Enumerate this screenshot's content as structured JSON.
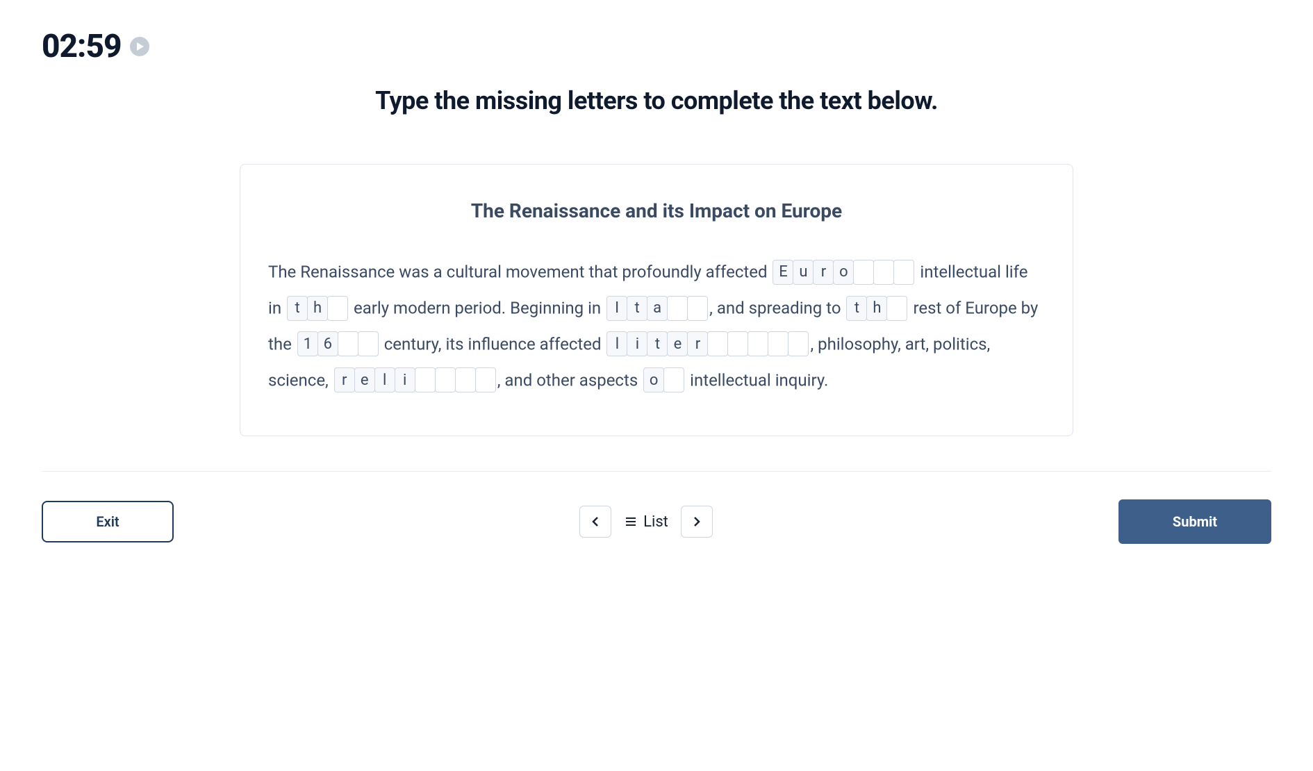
{
  "timer": "02:59",
  "instruction": "Type the missing letters to complete the text below.",
  "card": {
    "title": "The Renaissance and its Impact on Europe",
    "segments": [
      {
        "type": "text",
        "value": "The Renaissance was a cultural movement that profoundly affected "
      },
      {
        "type": "word",
        "letters": [
          "E",
          "u",
          "r",
          "o",
          "",
          "",
          ""
        ]
      },
      {
        "type": "text",
        "value": " intellectual life in "
      },
      {
        "type": "word",
        "letters": [
          "t",
          "h",
          ""
        ]
      },
      {
        "type": "text",
        "value": " early modern period. Beginning in "
      },
      {
        "type": "word",
        "letters": [
          "I",
          "t",
          "a",
          "",
          ""
        ]
      },
      {
        "type": "text",
        "value": ",  and spreading to "
      },
      {
        "type": "word",
        "letters": [
          "t",
          "h",
          ""
        ]
      },
      {
        "type": "text",
        "value": " rest of Europe by the "
      },
      {
        "type": "word",
        "letters": [
          "1",
          "6",
          "",
          ""
        ]
      },
      {
        "type": "text",
        "value": " century, its influence affected "
      },
      {
        "type": "word",
        "letters": [
          "l",
          "i",
          "t",
          "e",
          "r",
          "",
          "",
          "",
          "",
          ""
        ]
      },
      {
        "type": "text",
        "value": ",  philosophy, art, politics, science, "
      },
      {
        "type": "word",
        "letters": [
          "r",
          "e",
          "l",
          "i",
          "",
          "",
          "",
          ""
        ]
      },
      {
        "type": "text",
        "value": ",  and other aspects "
      },
      {
        "type": "word",
        "letters": [
          "o",
          ""
        ]
      },
      {
        "type": "text",
        "value": " intellectual inquiry."
      }
    ]
  },
  "footer": {
    "exit": "Exit",
    "list": "List",
    "submit": "Submit"
  }
}
